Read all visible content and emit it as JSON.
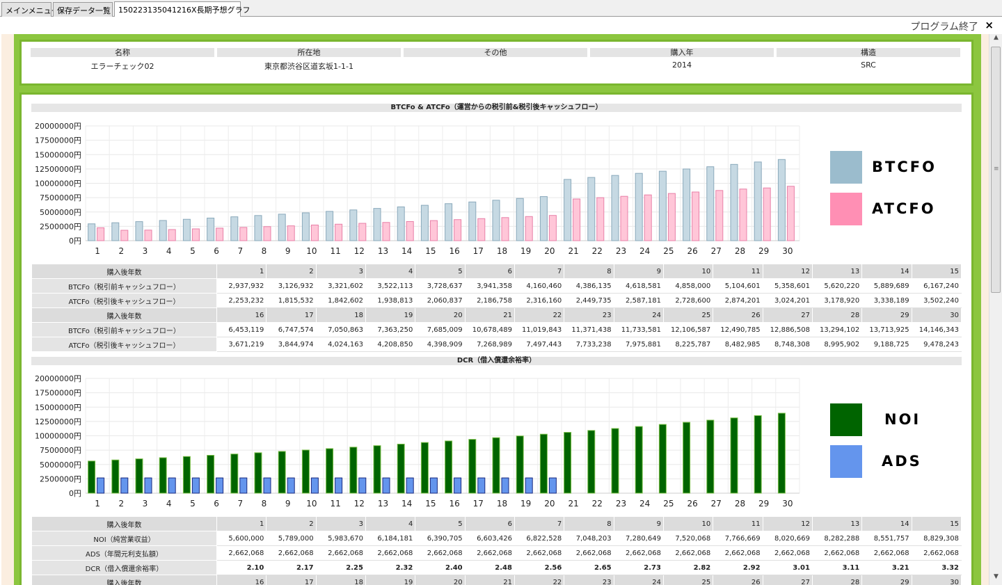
{
  "tabs": [
    "メインメニュー",
    "保存データ一覧",
    "150223135041216X長期予想グラフ"
  ],
  "exit_label": "プログラム終了",
  "close_symbol": "×",
  "info": {
    "headers": [
      "名称",
      "所在地",
      "その他",
      "購入年",
      "構造"
    ],
    "values": [
      "エラーチェック02",
      "東京都渋谷区道玄坂1-1-1",
      "",
      "2014",
      "SRC"
    ]
  },
  "btcfo_section": {
    "title": "BTCFo & ATCFo（運営からの税引前&税引後キャッシュフロー）",
    "legend": [
      {
        "label": "BTCFO",
        "color": "#9bbccd"
      },
      {
        "label": "ATCFO",
        "color": "#ff8fb4"
      }
    ],
    "row_labels": [
      "購入後年数",
      "BTCFo（税引前キャッシュフロー）",
      "ATCFo（税引後キャッシュフロー）"
    ]
  },
  "dcr_section": {
    "title": "DCR（借入償還余裕率）",
    "legend": [
      {
        "label": "NOI",
        "color": "#006400"
      },
      {
        "label": "ADS",
        "color": "#6495ed"
      }
    ],
    "row_labels": [
      "購入後年数",
      "NOI（純営業収益）",
      "ADS（年間元利支払額）",
      "DCR（借入償還余裕率）"
    ]
  },
  "chart_data": [
    {
      "type": "bar",
      "title": "BTCFo & ATCFo（運営からの税引前&税引後キャッシュフロー）",
      "categories": [
        "1",
        "2",
        "3",
        "4",
        "5",
        "6",
        "7",
        "8",
        "9",
        "10",
        "11",
        "12",
        "13",
        "14",
        "15",
        "16",
        "17",
        "18",
        "19",
        "20",
        "21",
        "22",
        "23",
        "24",
        "25",
        "26",
        "27",
        "28",
        "29",
        "30"
      ],
      "ytick_labels": [
        "0円",
        "2500000円",
        "5000000円",
        "7500000円",
        "10000000円",
        "12500000円",
        "15000000円",
        "17500000円",
        "20000000円"
      ],
      "ylim": [
        0,
        20000000
      ],
      "series": [
        {
          "name": "BTCFO",
          "color": "#c6d9e3",
          "values": [
            2937932,
            3126932,
            3321602,
            3522113,
            3728637,
            3941358,
            4160460,
            4386135,
            4618581,
            4858000,
            5104601,
            5358601,
            5620220,
            5889689,
            6167240,
            6453119,
            6747574,
            7050863,
            7363250,
            7685009,
            10678489,
            11019843,
            11371438,
            11733581,
            12106587,
            12490785,
            12886508,
            13294102,
            13713925,
            14146343
          ]
        },
        {
          "name": "ATCFO",
          "color": "#ffc6d8",
          "values": [
            2253232,
            1815532,
            1842602,
            1938813,
            2060837,
            2186758,
            2316160,
            2449735,
            2587181,
            2728600,
            2874201,
            3024201,
            3178920,
            3338189,
            3502240,
            3671219,
            3844974,
            4024163,
            4208850,
            4398909,
            7268989,
            7497443,
            7733238,
            7975881,
            8225787,
            8482985,
            8748308,
            8995902,
            9188725,
            9478243
          ]
        }
      ]
    },
    {
      "type": "bar",
      "title": "DCR（借入償還余裕率）",
      "categories": [
        "1",
        "2",
        "3",
        "4",
        "5",
        "6",
        "7",
        "8",
        "9",
        "10",
        "11",
        "12",
        "13",
        "14",
        "15",
        "16",
        "17",
        "18",
        "19",
        "20",
        "21",
        "22",
        "23",
        "24",
        "25",
        "26",
        "27",
        "28",
        "29",
        "30"
      ],
      "ytick_labels": [
        "0円",
        "2500000円",
        "5000000円",
        "7500000円",
        "10000000円",
        "12500000円",
        "15000000円",
        "17500000円",
        "20000000円"
      ],
      "ylim": [
        0,
        20000000
      ],
      "series": [
        {
          "name": "NOI",
          "color": "#006400",
          "values": [
            5600000,
            5789000,
            5983670,
            6184181,
            6390705,
            6603426,
            6822528,
            7048203,
            7280649,
            7520068,
            7766669,
            8020669,
            8282288,
            8551757,
            8829308,
            9100000,
            9380000,
            9670000,
            9970000,
            10280000,
            10600000,
            10930000,
            11270000,
            11620000,
            11980000,
            12350000,
            12730000,
            13120000,
            13520000,
            13940000
          ]
        },
        {
          "name": "ADS",
          "color": "#6495ed",
          "values": [
            2662068,
            2662068,
            2662068,
            2662068,
            2662068,
            2662068,
            2662068,
            2662068,
            2662068,
            2662068,
            2662068,
            2662068,
            2662068,
            2662068,
            2662068,
            2662068,
            2662068,
            2662068,
            2662068,
            2662068,
            0,
            0,
            0,
            0,
            0,
            0,
            0,
            0,
            0,
            0
          ]
        }
      ]
    }
  ],
  "btcfo_table": {
    "years_a": [
      "1",
      "2",
      "3",
      "4",
      "5",
      "6",
      "7",
      "8",
      "9",
      "10",
      "11",
      "12",
      "13",
      "14",
      "15"
    ],
    "btcfo_a": [
      "2,937,932",
      "3,126,932",
      "3,321,602",
      "3,522,113",
      "3,728,637",
      "3,941,358",
      "4,160,460",
      "4,386,135",
      "4,618,581",
      "4,858,000",
      "5,104,601",
      "5,358,601",
      "5,620,220",
      "5,889,689",
      "6,167,240"
    ],
    "atcfo_a": [
      "2,253,232",
      "1,815,532",
      "1,842,602",
      "1,938,813",
      "2,060,837",
      "2,186,758",
      "2,316,160",
      "2,449,735",
      "2,587,181",
      "2,728,600",
      "2,874,201",
      "3,024,201",
      "3,178,920",
      "3,338,189",
      "3,502,240"
    ],
    "years_b": [
      "16",
      "17",
      "18",
      "19",
      "20",
      "21",
      "22",
      "23",
      "24",
      "25",
      "26",
      "27",
      "28",
      "29",
      "30"
    ],
    "btcfo_b": [
      "6,453,119",
      "6,747,574",
      "7,050,863",
      "7,363,250",
      "7,685,009",
      "10,678,489",
      "11,019,843",
      "11,371,438",
      "11,733,581",
      "12,106,587",
      "12,490,785",
      "12,886,508",
      "13,294,102",
      "13,713,925",
      "14,146,343"
    ],
    "atcfo_b": [
      "3,671,219",
      "3,844,974",
      "4,024,163",
      "4,208,850",
      "4,398,909",
      "7,268,989",
      "7,497,443",
      "7,733,238",
      "7,975,881",
      "8,225,787",
      "8,482,985",
      "8,748,308",
      "8,995,902",
      "9,188,725",
      "9,478,243"
    ]
  },
  "dcr_table": {
    "years_a": [
      "1",
      "2",
      "3",
      "4",
      "5",
      "6",
      "7",
      "8",
      "9",
      "10",
      "11",
      "12",
      "13",
      "14",
      "15"
    ],
    "noi_a": [
      "5,600,000",
      "5,789,000",
      "5,983,670",
      "6,184,181",
      "6,390,705",
      "6,603,426",
      "6,822,528",
      "7,048,203",
      "7,280,649",
      "7,520,068",
      "7,766,669",
      "8,020,669",
      "8,282,288",
      "8,551,757",
      "8,829,308"
    ],
    "ads_a": [
      "2,662,068",
      "2,662,068",
      "2,662,068",
      "2,662,068",
      "2,662,068",
      "2,662,068",
      "2,662,068",
      "2,662,068",
      "2,662,068",
      "2,662,068",
      "2,662,068",
      "2,662,068",
      "2,662,068",
      "2,662,068",
      "2,662,068"
    ],
    "dcr_a": [
      "2.10",
      "2.17",
      "2.25",
      "2.32",
      "2.40",
      "2.48",
      "2.56",
      "2.65",
      "2.73",
      "2.82",
      "2.92",
      "3.01",
      "3.11",
      "3.21",
      "3.32"
    ],
    "years_b": [
      "16",
      "17",
      "18",
      "19",
      "20",
      "21",
      "22",
      "23",
      "24",
      "25",
      "26",
      "27",
      "28",
      "29",
      "30"
    ]
  }
}
